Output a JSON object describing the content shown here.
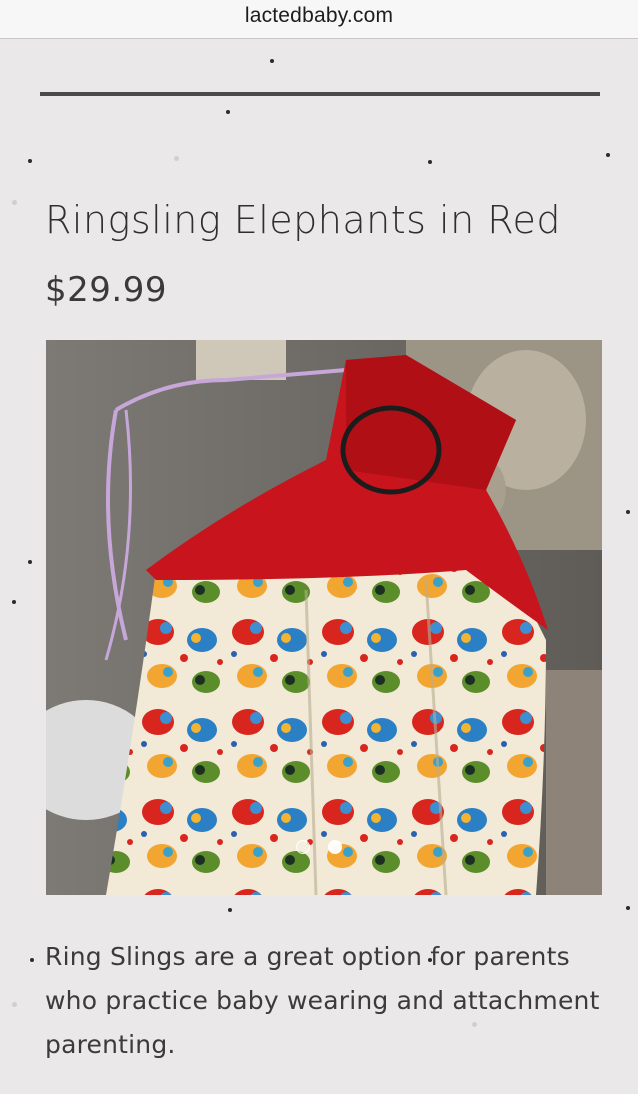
{
  "browser": {
    "url": "lactedbaby.com"
  },
  "product": {
    "title": "Ringsling Elephants in Red",
    "price": "$29.99",
    "description": "Ring Slings are a great option for parents who practice baby wearing and attachment parenting.",
    "gallery": {
      "slide_count": 2,
      "active_slide": 2
    }
  },
  "colors": {
    "background": "#eae8e9",
    "sling_red": "#c8141c",
    "fabric_cream": "#f2ead6",
    "text": "#3a3a3a"
  }
}
